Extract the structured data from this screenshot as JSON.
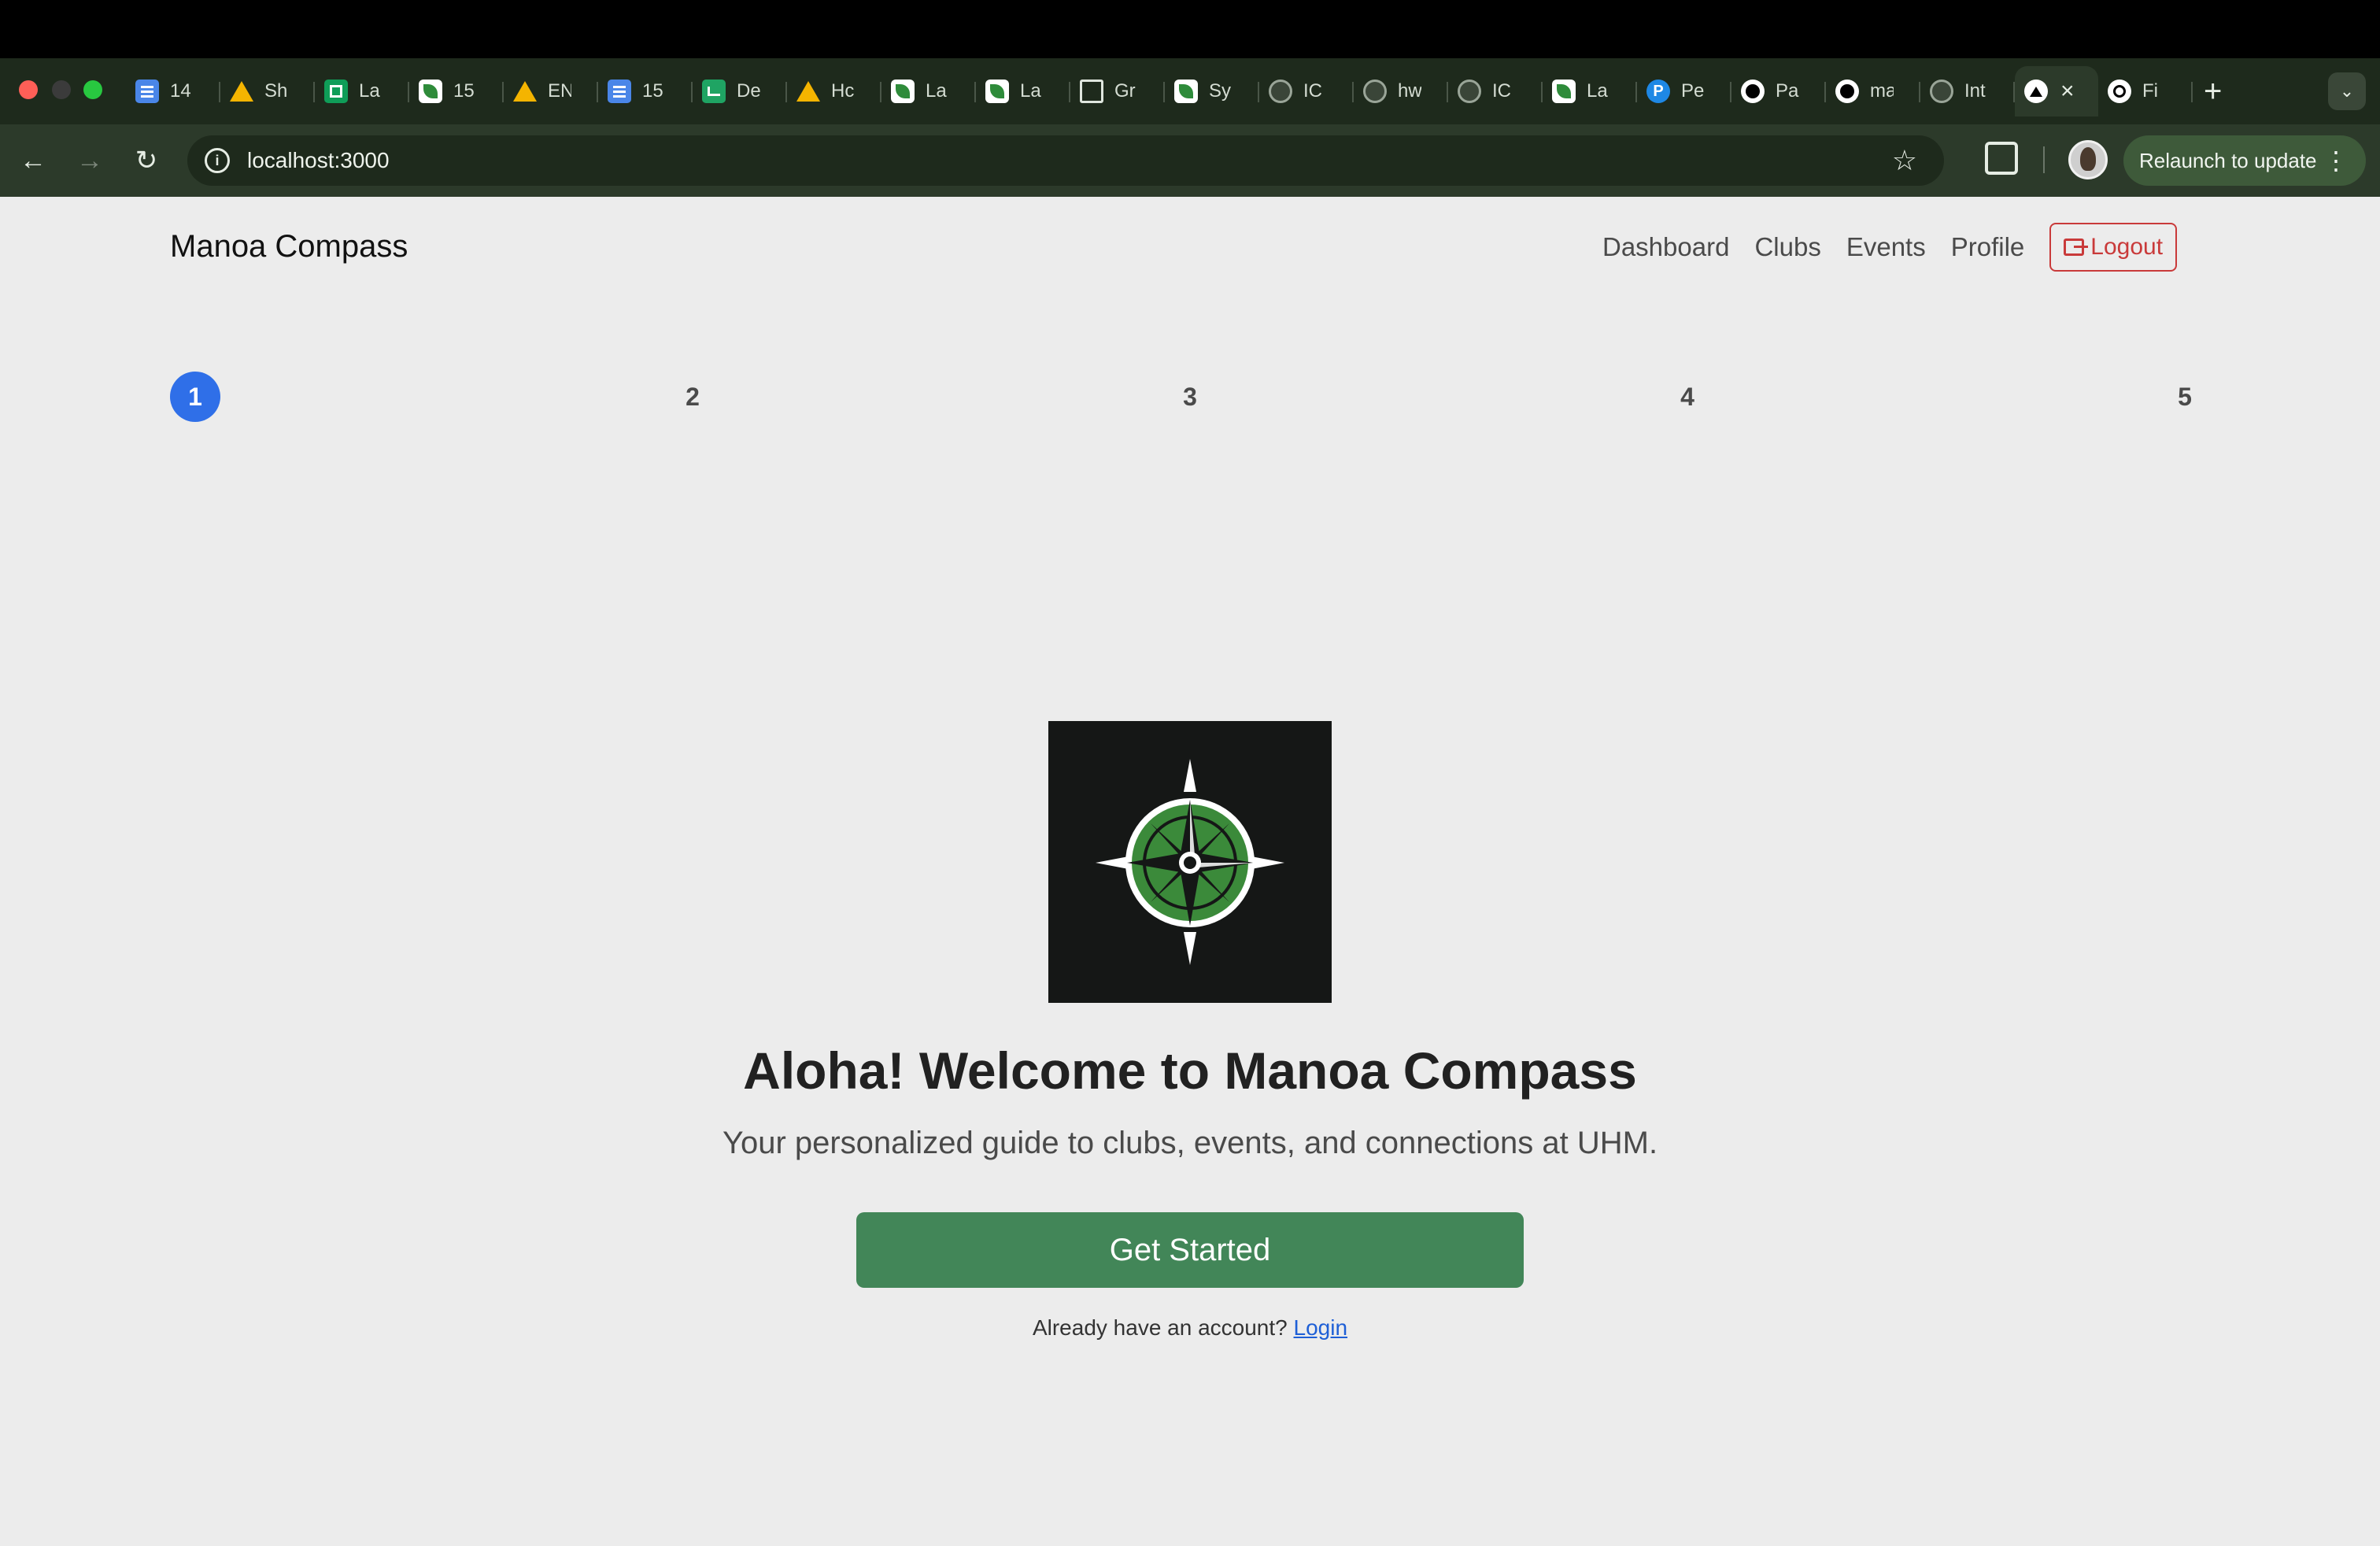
{
  "browser": {
    "tabs": [
      {
        "icon": "google-docs-icon",
        "title": "14"
      },
      {
        "icon": "google-drive-icon",
        "title": "Sh"
      },
      {
        "icon": "google-sheets-icon",
        "title": "La"
      },
      {
        "icon": "leaf-icon",
        "title": "15"
      },
      {
        "icon": "google-drive-icon",
        "title": "EN"
      },
      {
        "icon": "google-docs-icon",
        "title": "15"
      },
      {
        "icon": "chart-icon",
        "title": "De"
      },
      {
        "icon": "google-drive-icon",
        "title": "Hc"
      },
      {
        "icon": "leaf-icon",
        "title": "La"
      },
      {
        "icon": "leaf-icon",
        "title": "La"
      },
      {
        "icon": "calculator-icon",
        "title": "Gr"
      },
      {
        "icon": "leaf-icon",
        "title": "Sy"
      },
      {
        "icon": "globe-icon",
        "title": "IC"
      },
      {
        "icon": "globe-icon",
        "title": "hw"
      },
      {
        "icon": "globe-icon",
        "title": "IC"
      },
      {
        "icon": "leaf-icon",
        "title": "La"
      },
      {
        "icon": "p-icon",
        "title": "Pe"
      },
      {
        "icon": "github-icon",
        "title": "Pa"
      },
      {
        "icon": "github-icon",
        "title": "ma"
      },
      {
        "icon": "globe-icon",
        "title": "Int"
      },
      {
        "icon": "vercel-icon",
        "title": ""
      },
      {
        "icon": "openai-icon",
        "title": "Fi"
      }
    ],
    "url": "localhost:3000",
    "relaunch_label": "Relaunch to update"
  },
  "navbar": {
    "brand": "Manoa Compass",
    "links": [
      "Dashboard",
      "Clubs",
      "Events",
      "Profile"
    ],
    "logout_label": "Logout"
  },
  "steps": [
    "1",
    "2",
    "3",
    "4",
    "5"
  ],
  "hero": {
    "title": "Aloha! Welcome to Manoa Compass",
    "subtitle": "Your personalized guide to clubs, events, and connections at UHM.",
    "cta_label": "Get Started",
    "login_prompt": "Already have an account?",
    "login_link": "Login"
  },
  "colors": {
    "primary": "#428658",
    "step_active": "#2f6fe8",
    "logout": "#c93a3a",
    "link": "#1e5fd6"
  }
}
